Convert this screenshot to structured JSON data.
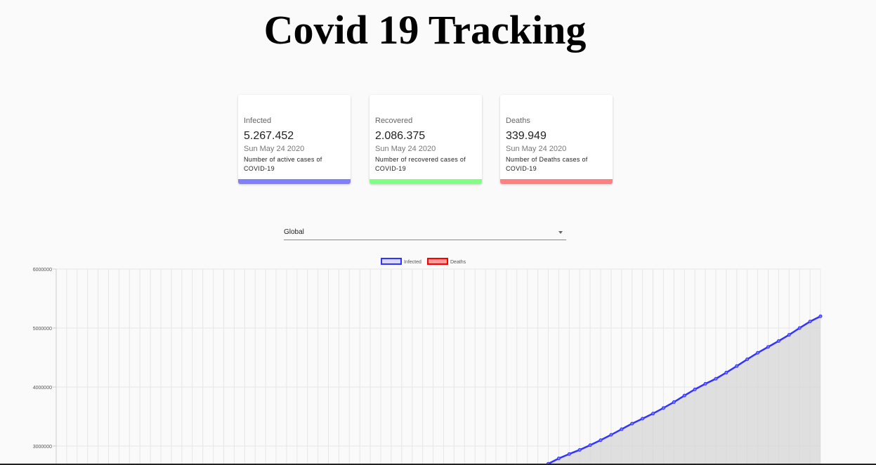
{
  "header": {
    "title": "Covid 19 Tracking"
  },
  "cards": [
    {
      "label": "Infected",
      "value": "5.267.452",
      "date": "Sun May 24 2020",
      "description": "Number of active cases of COVID-19",
      "color": "#8080ff"
    },
    {
      "label": "Recovered",
      "value": "2.086.375",
      "date": "Sun May 24 2020",
      "description": "Number of recovered cases of COVID-19",
      "color": "#80ff80"
    },
    {
      "label": "Deaths",
      "value": "339.949",
      "date": "Sun May 24 2020",
      "description": "Number of Deaths cases of COVID-19",
      "color": "#ff8080"
    }
  ],
  "country_picker": {
    "selected": "Global"
  },
  "chart_data": {
    "type": "line",
    "title": "",
    "xlabel": "",
    "ylabel": "",
    "ylim": [
      2700000,
      6000000
    ],
    "yticks": [
      "6000000",
      "5000000",
      "4000000",
      "3000000"
    ],
    "grid": true,
    "legend_position": "top",
    "series": [
      {
        "name": "Infected",
        "color": "#3333ff",
        "fill": "rgba(0,0,0,0.1)",
        "values": [
          null,
          null,
          null,
          null,
          null,
          null,
          null,
          null,
          null,
          null,
          null,
          null,
          null,
          null,
          null,
          null,
          null,
          null,
          null,
          null,
          null,
          null,
          null,
          null,
          null,
          null,
          null,
          null,
          null,
          null,
          null,
          null,
          null,
          null,
          null,
          null,
          null,
          null,
          null,
          null,
          null,
          null,
          null,
          null,
          null,
          null,
          null,
          2700000,
          2790000,
          2865000,
          2935000,
          3015000,
          3100000,
          3190000,
          3285000,
          3380000,
          3465000,
          3550000,
          3645000,
          3745000,
          3855000,
          3960000,
          4055000,
          4140000,
          4245000,
          4355000,
          4470000,
          4580000,
          4680000,
          4780000,
          4885000,
          5000000,
          5110000,
          5200000
        ]
      },
      {
        "name": "Deaths",
        "color": "#ff0000",
        "fill": "rgba(255,0,0,0.5)",
        "values": []
      }
    ]
  }
}
